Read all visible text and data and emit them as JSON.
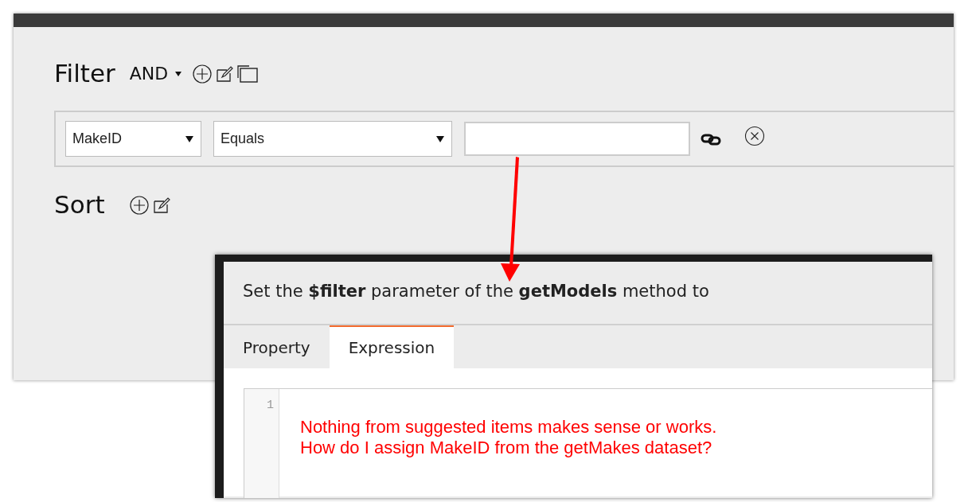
{
  "filter": {
    "title": "Filter",
    "logic": "AND",
    "row": {
      "field": "MakeID",
      "operator": "Equals"
    }
  },
  "sort": {
    "title": "Sort"
  },
  "dialog": {
    "title": "Set the **$filter** parameter of the **getModels** method to",
    "tabs": [
      {
        "label": "Property",
        "selected": false
      },
      {
        "label": "Expression",
        "selected": true
      }
    ],
    "editor": {
      "line_number": "1",
      "annotation": [
        "Nothing from suggested items makes sense or works.",
        "How do I assign MakeID from the getMakes dataset?"
      ]
    }
  }
}
